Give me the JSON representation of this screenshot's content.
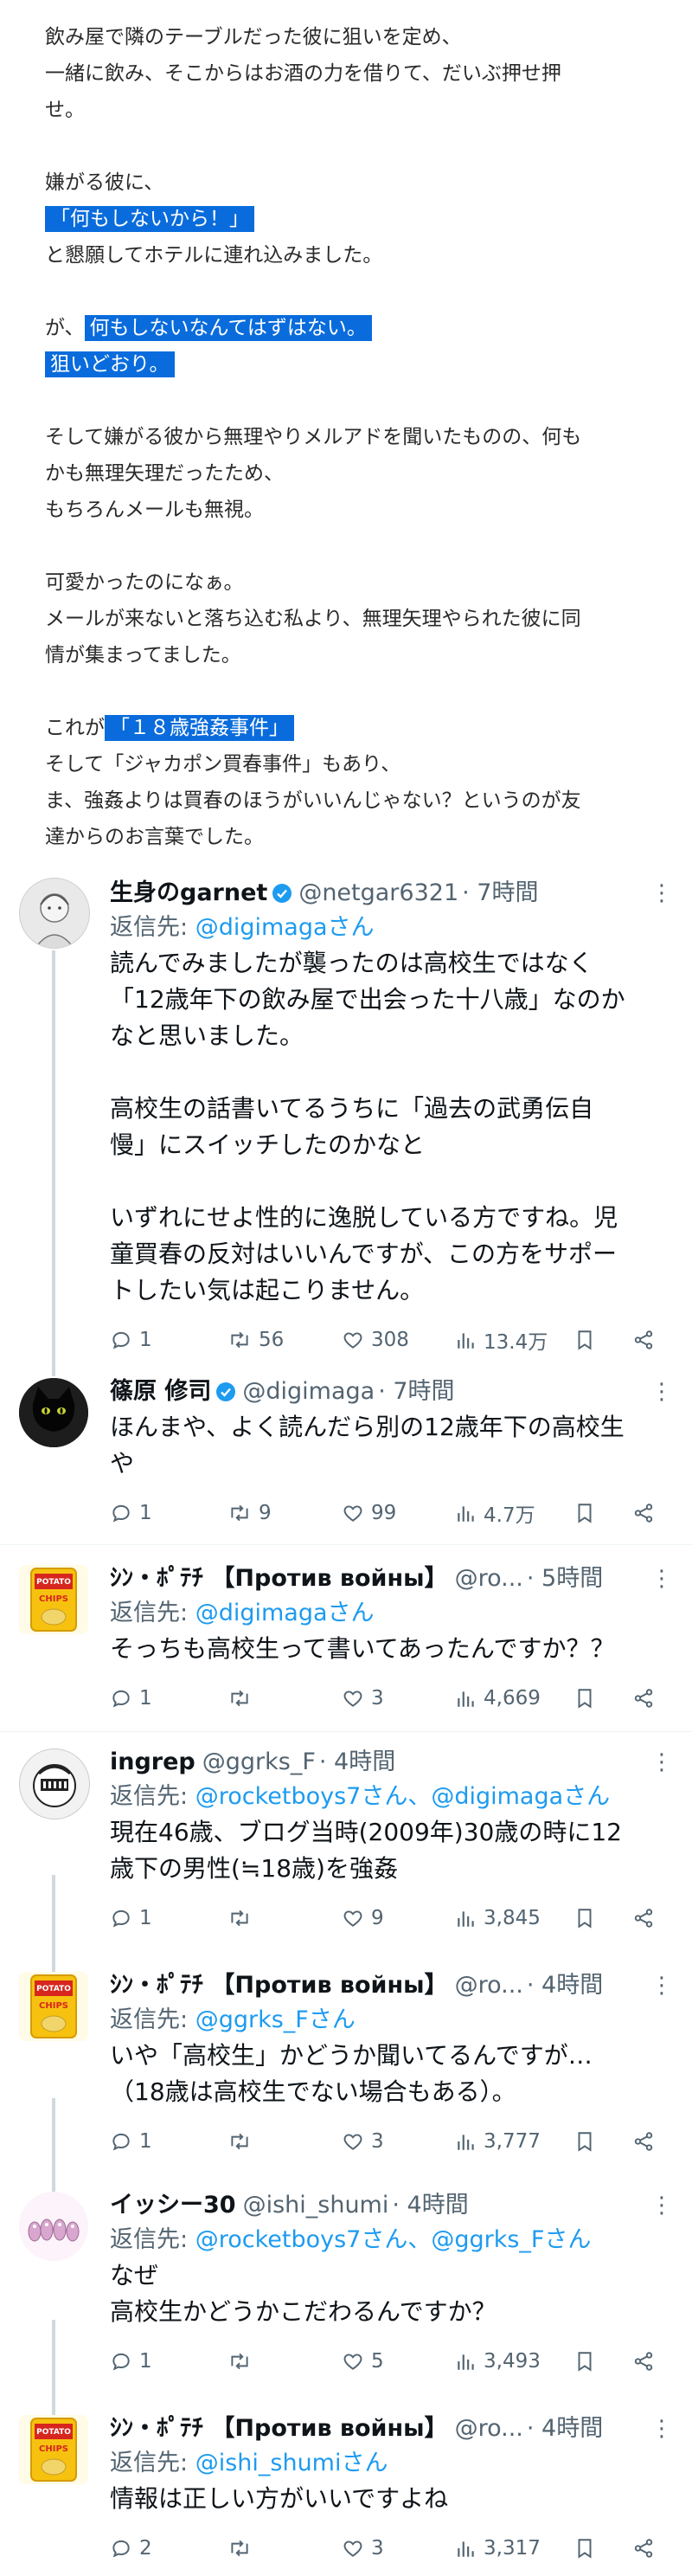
{
  "article": {
    "lines": [
      "飲み屋で隣のテーブルだった彼に狙いを定め、",
      "一緒に飲み、そこからはお酒の力を借りて、だいぶ押せ押",
      "せ。",
      "",
      "嫌がる彼に、",
      "「何もしないから！」",
      "と懇願してホテルに連れ込みました。",
      "",
      "が、何もしないなんてはずはない。",
      "狙いどおり。",
      "",
      "そして嫌がる彼から無理やりメルアドを聞いたものの、何も",
      "かも無理矢理だったため、",
      "もちろんメールも無視。",
      "",
      "可愛かったのになぁ。",
      "メールが来ないと落ち込む私より、無理矢理やられた彼に同",
      "情が集まってました。",
      "",
      "これが「１８歳強姦事件」",
      "そして「ジャカポン買春事件」もあり、",
      "ま、強姦よりは買春のほうがいいんじゃない？というのが友",
      "達からのお言葉でした。"
    ],
    "hl_1": "「何もしないから！」",
    "hl_2a_pre": "が、",
    "hl_2a": "何もしないなんてはずはない。",
    "hl_2b": "狙いどおり。",
    "hl_3_pre": "これが",
    "hl_3": "「１８歳強姦事件」"
  },
  "reply_prefix": "返信先:",
  "tweets": [
    {
      "name": "生身のgarnet",
      "verified": true,
      "handle": "@netgar6321",
      "time": "· 7時間",
      "reply_to": "@digimagaさん",
      "body": [
        "読んでみましたが襲ったのは高校生ではなく",
        "「12歳年下の飲み屋で出会った十八歳」なのか",
        "なと思いました。",
        "",
        "高校生の話書いてるうちに「過去の武勇伝自",
        "慢」にスイッチしたのかなと",
        "",
        "いずれにせよ性的に逸脱している方ですね。児",
        "童買春の反対はいいんですが、この方をサポー",
        "トしたい気は起こりません。"
      ],
      "replies": "1",
      "retweets": "56",
      "likes": "308",
      "views": "13.4万"
    },
    {
      "name": "篠原 修司",
      "verified": true,
      "handle": "@digimaga",
      "time": "· 7時間",
      "reply_to": "",
      "body": [
        "ほんまや、よく読んだら別の12歳年下の高校生",
        "や"
      ],
      "replies": "1",
      "retweets": "9",
      "likes": "99",
      "views": "4.7万"
    },
    {
      "name": "ｼﾝ・ﾎﾟﾃﾁ 【Против войны】",
      "verified": false,
      "handle": "@ro...",
      "time": "· 5時間",
      "reply_to": "@digimagaさん",
      "body": [
        "そっちも高校生って書いてあったんですか？？"
      ],
      "replies": "1",
      "retweets": "",
      "likes": "3",
      "views": "4,669"
    },
    {
      "name": "ingrep",
      "verified": false,
      "handle": "@ggrks_F",
      "time": "· 4時間",
      "reply_to": "@rocketboys7さん、@digimagaさん",
      "body": [
        "現在46歳、ブログ当時(2009年)30歳の時に12",
        "歳下の男性(≒18歳)を強姦"
      ],
      "replies": "1",
      "retweets": "",
      "likes": "9",
      "views": "3,845"
    },
    {
      "name": "ｼﾝ・ﾎﾟﾃﾁ 【Против войны】",
      "verified": false,
      "handle": "@ro...",
      "time": "· 4時間",
      "reply_to": "@ggrks_Fさん",
      "body": [
        "いや「高校生」かどうか聞いてるんですが…",
        "（18歳は高校生でない場合もある）。"
      ],
      "replies": "1",
      "retweets": "",
      "likes": "3",
      "views": "3,777"
    },
    {
      "name": "イッシー30",
      "verified": false,
      "handle": "@ishi_shumi",
      "time": "· 4時間",
      "reply_to": "@rocketboys7さん、@ggrks_Fさん",
      "body": [
        "なぜ",
        "高校生かどうかこだわるんですか？"
      ],
      "replies": "1",
      "retweets": "",
      "likes": "5",
      "views": "3,493"
    },
    {
      "name": "ｼﾝ・ﾎﾟﾃﾁ 【Против войны】",
      "verified": false,
      "handle": "@ro...",
      "time": "· 4時間",
      "reply_to": "@ishi_shumiさん",
      "body": [
        "情報は正しい方がいいですよね"
      ],
      "replies": "2",
      "retweets": "",
      "likes": "3",
      "views": "3,317"
    }
  ],
  "avatar_texts": {
    "chips": "POTATO CHIPS"
  },
  "colors": {
    "highlight": "#0a6cdc",
    "link": "#1d9bf0",
    "muted": "#536471",
    "verified": "#1d9bf0"
  }
}
